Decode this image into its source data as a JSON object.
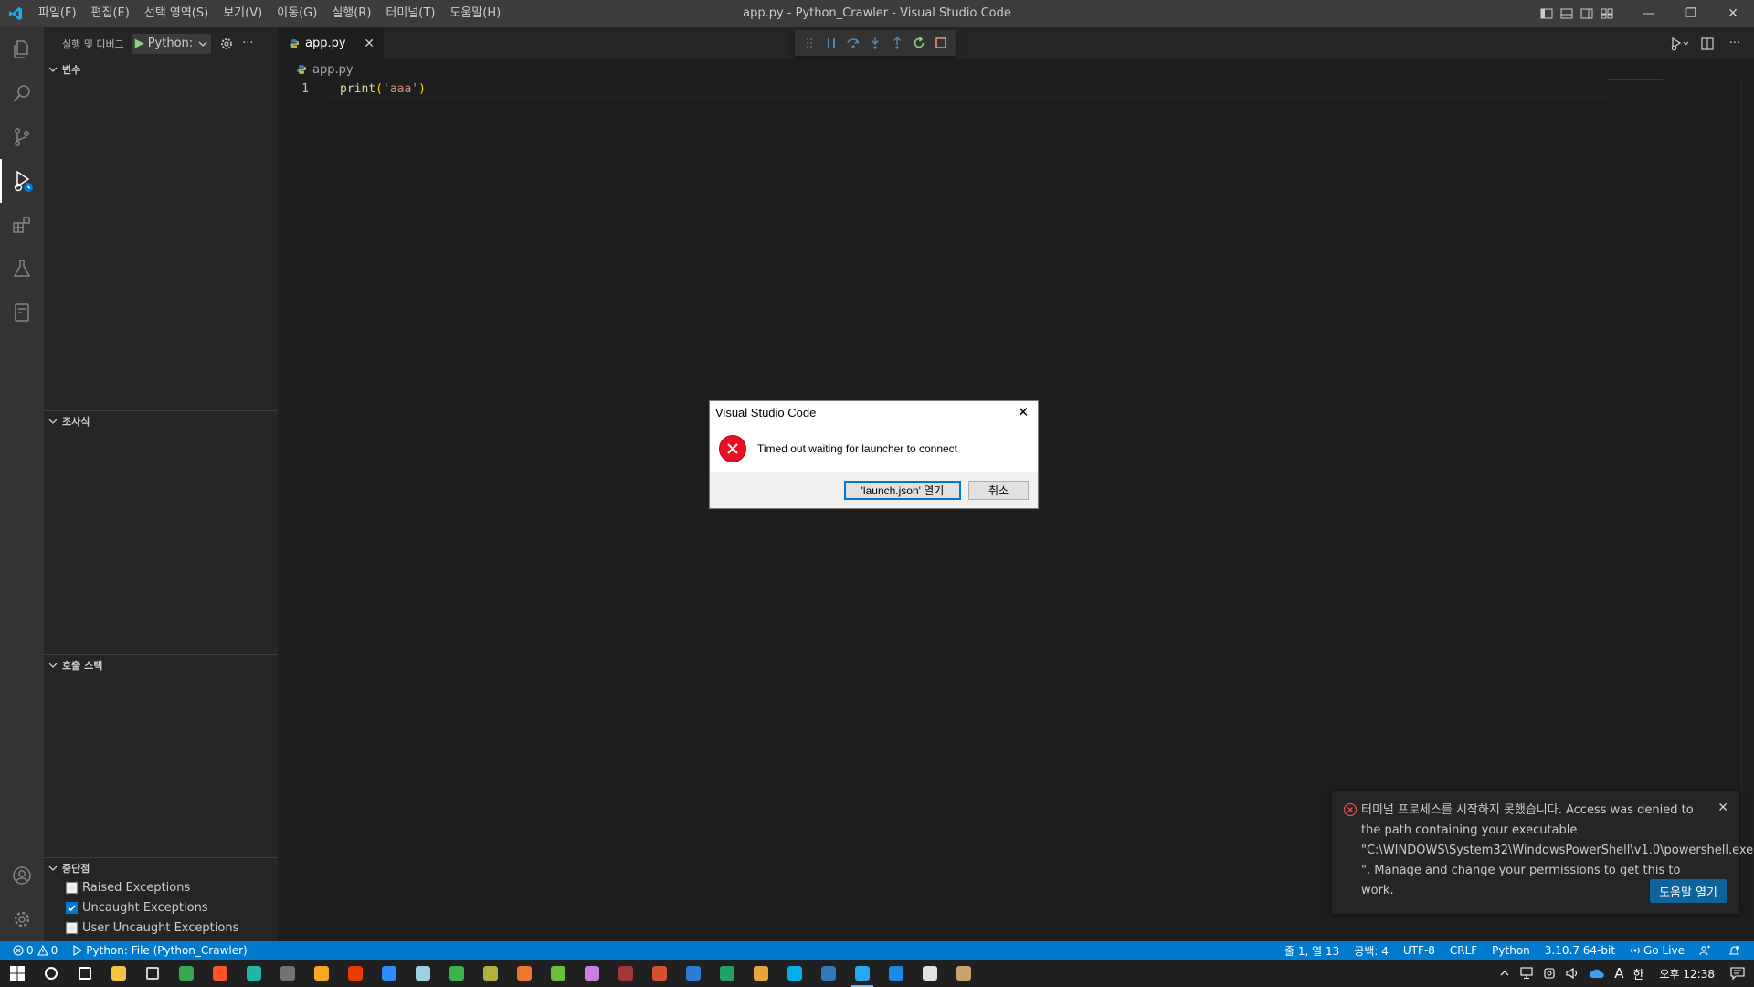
{
  "window": {
    "title": "app.py - Python_Crawler - Visual Studio Code",
    "minimize": "—",
    "restore": "❐",
    "close": "✕"
  },
  "menu": [
    "파일(F)",
    "편집(E)",
    "선택 영역(S)",
    "보기(V)",
    "이동(G)",
    "실행(R)",
    "터미널(T)",
    "도움말(H)"
  ],
  "sidebar": {
    "title": "실행 및 디버그",
    "config": "Python:",
    "more": "···",
    "sections": {
      "variables": "변수",
      "watch": "조사식",
      "call_stack": "호출 스택",
      "breakpoints": "중단점"
    },
    "breakpoints": [
      {
        "label": "Raised Exceptions",
        "checked": false
      },
      {
        "label": "Uncaught Exceptions",
        "checked": true
      },
      {
        "label": "User Uncaught Exceptions",
        "checked": false
      }
    ]
  },
  "editor": {
    "tab_label": "app.py",
    "tab_close": "✕",
    "breadcrumb": "app.py",
    "line_number": "1",
    "code": {
      "fn": "print",
      "open": "(",
      "str": "'aaa'",
      "close": ")"
    },
    "more": "···"
  },
  "dialog": {
    "title": "Visual Studio Code",
    "close": "✕",
    "message": "Timed out waiting for launcher to connect",
    "primary_button": "'launch.json' 열기",
    "cancel_button": "취소"
  },
  "notification": {
    "message": "터미널 프로세스를 시작하지 못했습니다. Access was denied to the path containing your executable \"C:\\WINDOWS\\System32\\WindowsPowerShell\\v1.0\\powershell.exe\n\". Manage and change your permissions to get this to work.",
    "button": "도움말 열기",
    "close": "✕"
  },
  "statusbar": {
    "errors": "0",
    "warnings": "0",
    "debug_target": "Python: File (Python_Crawler)",
    "position": "줄 1, 열 13",
    "spaces": "공백: 4",
    "encoding": "UTF-8",
    "eol": "CRLF",
    "language": "Python",
    "interpreter": "3.10.7 64-bit",
    "golive": "Go Live"
  },
  "taskbar": {
    "apps": [
      {
        "name": "search",
        "color": "#ffffff"
      },
      {
        "name": "task-view",
        "color": "#ffffff"
      },
      {
        "name": "file-explorer",
        "color": "#f4c542"
      },
      {
        "name": "settings",
        "color": "#cfcfcf"
      },
      {
        "name": "chrome",
        "color": "#34a853"
      },
      {
        "name": "brave",
        "color": "#fb542b"
      },
      {
        "name": "edge-dev",
        "color": "#1fb5a8"
      },
      {
        "name": "calculator",
        "color": "#737373"
      },
      {
        "name": "edge",
        "color": "#f5a623"
      },
      {
        "name": "office",
        "color": "#eb3c00"
      },
      {
        "name": "zoom",
        "color": "#2d8cff"
      },
      {
        "name": "notepad",
        "color": "#9dd2e5"
      },
      {
        "name": "vpn",
        "color": "#3ab54a"
      },
      {
        "name": "app-dark",
        "color": "#b6b03f"
      },
      {
        "name": "butterfly",
        "color": "#e8792f"
      },
      {
        "name": "app-green",
        "color": "#6bbf3a"
      },
      {
        "name": "onenote",
        "color": "#c77fe0"
      },
      {
        "name": "access",
        "color": "#a4373a"
      },
      {
        "name": "powerpoint",
        "color": "#d35230"
      },
      {
        "name": "word",
        "color": "#2b7cd3"
      },
      {
        "name": "excel",
        "color": "#21a366"
      },
      {
        "name": "app-orange",
        "color": "#e8a33b"
      },
      {
        "name": "skype",
        "color": "#00aff0"
      },
      {
        "name": "app-blue",
        "color": "#2f79b7"
      },
      {
        "name": "vscode",
        "color": "#23a9f2"
      },
      {
        "name": "app-pin",
        "color": "#1e88e5"
      },
      {
        "name": "app-figure",
        "color": "#e0e0e0"
      },
      {
        "name": "snipping",
        "color": "#c7a46c"
      }
    ],
    "ime_letter": "A",
    "ime_lang": "한",
    "clock": "오후 12:38"
  },
  "colors": {
    "accent": "#007acc",
    "error": "#f14c4c",
    "dialog_error": "#e81123",
    "button_primary": "#0e639c"
  }
}
